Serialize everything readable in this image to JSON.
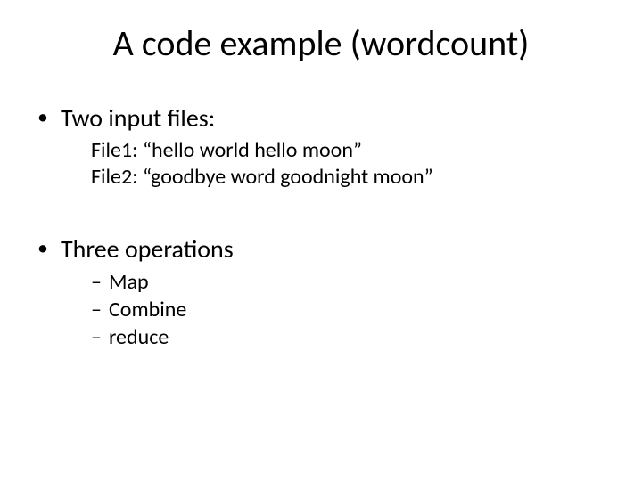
{
  "title": "A code example (wordcount)",
  "bullets": {
    "b1": {
      "label": "Two input files:",
      "sub": {
        "l1": "File1: “hello world hello moon”",
        "l2": "File2: “goodbye word goodnight moon”"
      }
    },
    "b2": {
      "label": "Three operations",
      "items": {
        "i1": "Map",
        "i2": "Combine",
        "i3": "reduce"
      }
    }
  }
}
